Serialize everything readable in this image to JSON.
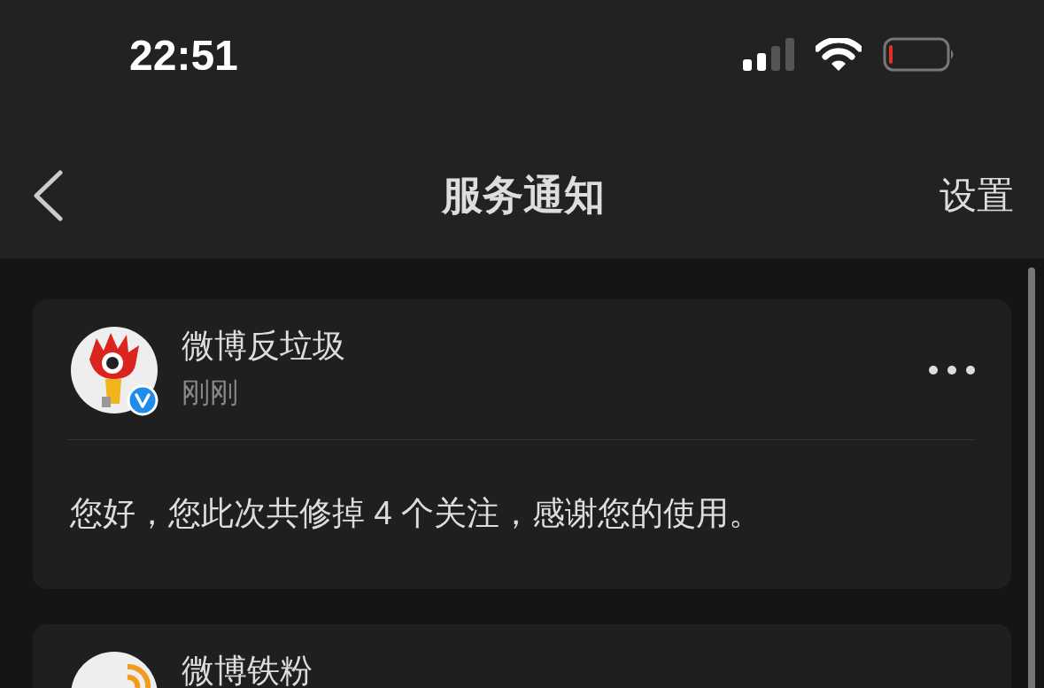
{
  "status_bar": {
    "time": "22:51"
  },
  "nav_bar": {
    "title": "服务通知",
    "action": "设置"
  },
  "notifications": [
    {
      "sender": "微博反垃圾",
      "time": "刚刚",
      "verified": true,
      "kind": "eye",
      "message": "您好，您此次共修掉 4 个关注，感谢您的使用。"
    },
    {
      "sender": "微博铁粉",
      "kind": "signal"
    }
  ]
}
